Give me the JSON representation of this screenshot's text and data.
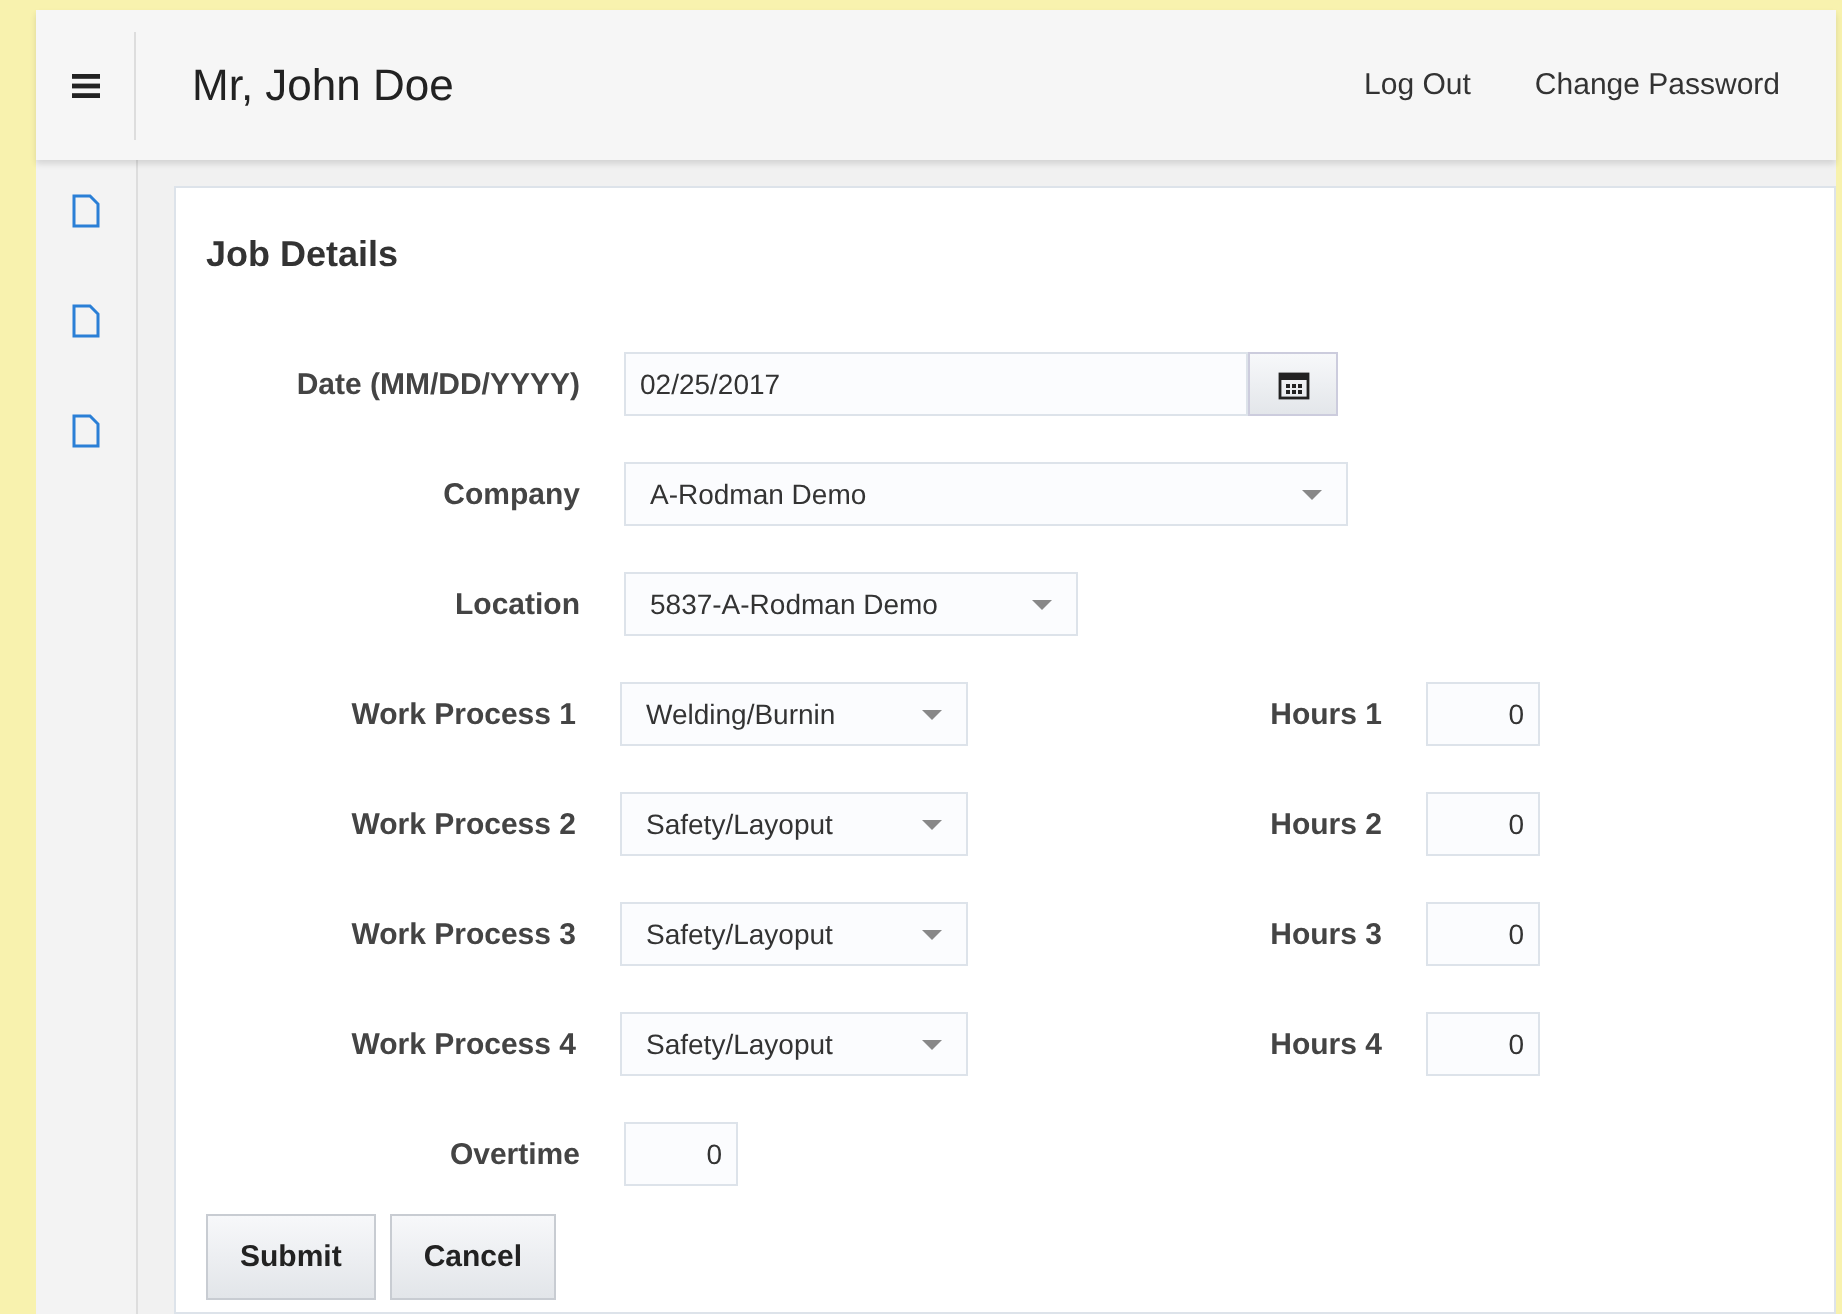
{
  "header": {
    "user_name": "Mr, John Doe",
    "links": [
      "Log Out",
      "Change Password"
    ]
  },
  "form": {
    "title": "Job Details",
    "date": {
      "label": "Date (MM/DD/YYYY)",
      "value": "02/25/2017"
    },
    "company": {
      "label": "Company",
      "value": "A-Rodman Demo"
    },
    "location": {
      "label": "Location",
      "value": "5837-A-Rodman Demo"
    },
    "work_processes": [
      {
        "label": "Work Process 1",
        "value": "Welding/Burnin",
        "hours_label": "Hours 1",
        "hours": "0"
      },
      {
        "label": "Work Process 2",
        "value": "Safety/Layoput",
        "hours_label": "Hours 2",
        "hours": "0"
      },
      {
        "label": "Work Process 3",
        "value": "Safety/Layoput",
        "hours_label": "Hours 3",
        "hours": "0"
      },
      {
        "label": "Work Process 4",
        "value": "Safety/Layoput",
        "hours_label": "Hours 4",
        "hours": "0"
      }
    ],
    "overtime": {
      "label": "Overtime",
      "value": "0"
    },
    "buttons": [
      "Submit",
      "Cancel"
    ]
  }
}
